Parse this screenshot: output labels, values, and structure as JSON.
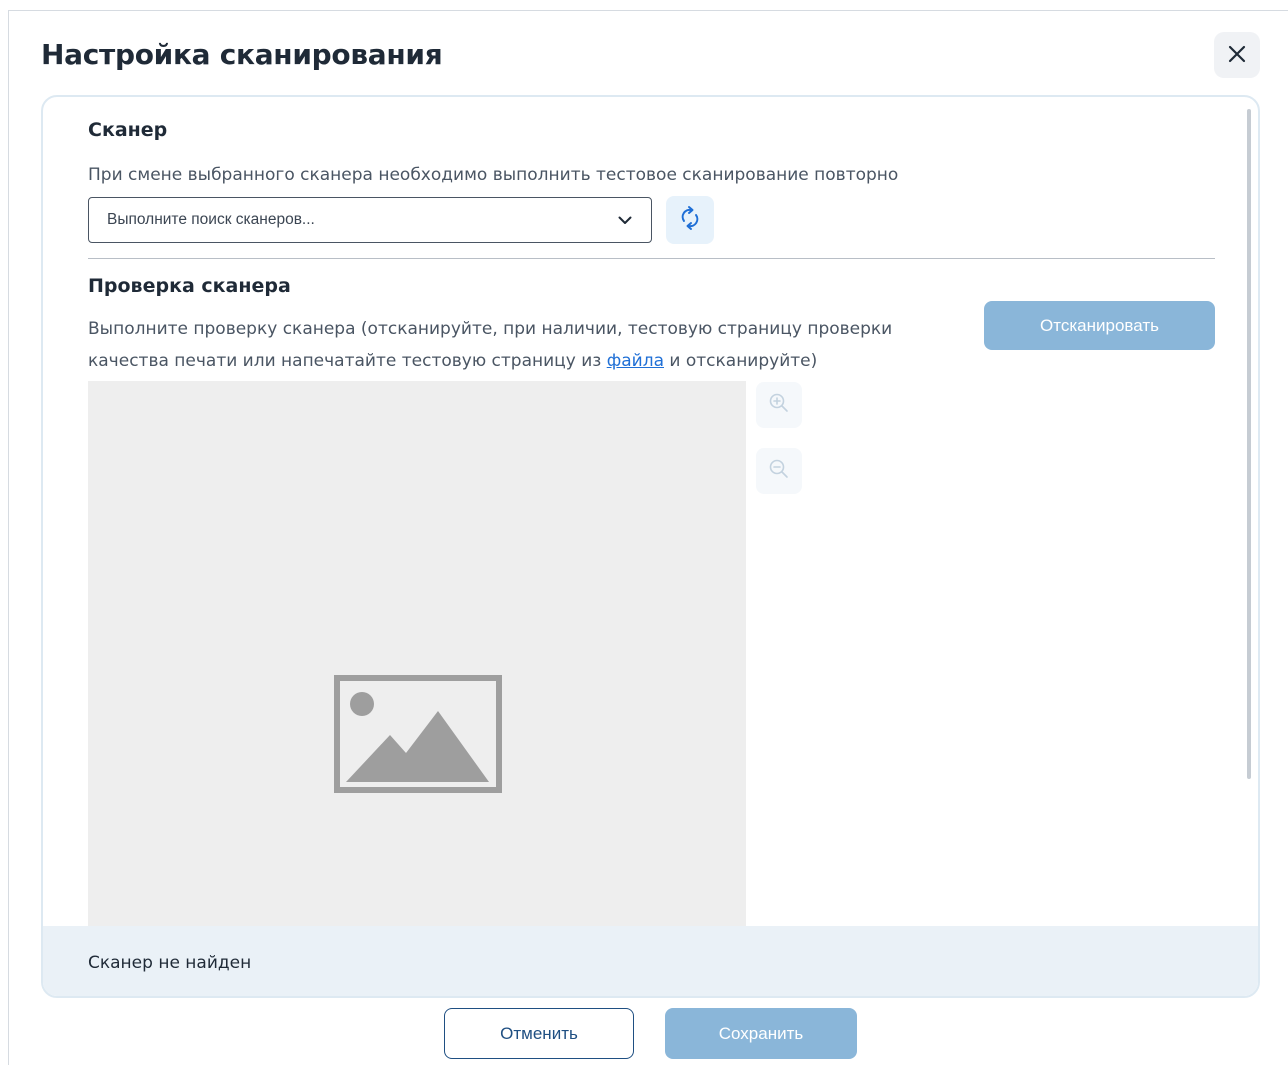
{
  "dialog": {
    "title": "Настройка сканирования",
    "close_icon": "close-icon"
  },
  "scanner_section": {
    "title": "Сканер",
    "hint": "При смене выбранного сканера необходимо выполнить тестовое сканирование повторно",
    "select": {
      "placeholder": "Выполните поиск сканеров...",
      "icon": "chevron-down-icon"
    },
    "refresh_icon": "refresh-icon"
  },
  "check_section": {
    "title": "Проверка сканера",
    "hint_before": "Выполните проверку сканера (отсканируйте, при наличии, тестовую страницу проверки качества печати или напечатайте тестовую страницу из ",
    "hint_link": "файла",
    "hint_after": " и отсканируйте)",
    "scan_button": "Отсканировать",
    "preview_icon": "image-placeholder-icon",
    "zoom_in_icon": "zoom-in-icon",
    "zoom_out_icon": "zoom-out-icon"
  },
  "status": {
    "text": "Сканер не найден"
  },
  "footer": {
    "cancel_label": "Отменить",
    "save_label": "Сохранить"
  },
  "colors": {
    "accent_disabled": "#8ab6d9",
    "link": "#1f6fd6",
    "status_bg": "#eaf1f7",
    "preview_bg": "#eeeeee"
  }
}
